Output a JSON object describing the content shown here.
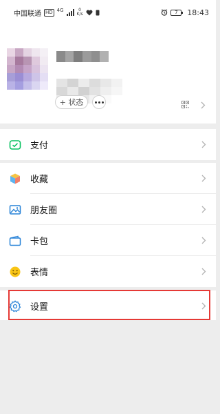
{
  "status_bar": {
    "carrier": "中国联通",
    "hd_badge": "HD",
    "network_type": "4G",
    "speed_value": "0",
    "speed_unit": "K/s",
    "battery_level": "7",
    "time": "18:43",
    "icons": [
      "hd-icon",
      "signal-icon",
      "heart-icon",
      "sim-icon",
      "alarm-icon",
      "battery-icon"
    ]
  },
  "profile": {
    "status_button_label": "+ 状态",
    "more_button_icon": "ellipsis-icon",
    "qr_icon": "qr-code-icon"
  },
  "menu": {
    "items": [
      {
        "label": "支付",
        "icon": "pay-icon",
        "accent": "#07c160"
      },
      {
        "label": "收藏",
        "icon": "favorites-icon",
        "accent": "#f0a63b"
      },
      {
        "label": "朋友圈",
        "icon": "moments-icon",
        "accent": "#2782d7"
      },
      {
        "label": "卡包",
        "icon": "card-wallet-icon",
        "accent": "#2782d7"
      },
      {
        "label": "表情",
        "icon": "sticker-icon",
        "accent": "#f5b700"
      },
      {
        "label": "设置",
        "icon": "settings-icon",
        "accent": "#2782d7"
      }
    ]
  },
  "highlight_color": "#e53935"
}
